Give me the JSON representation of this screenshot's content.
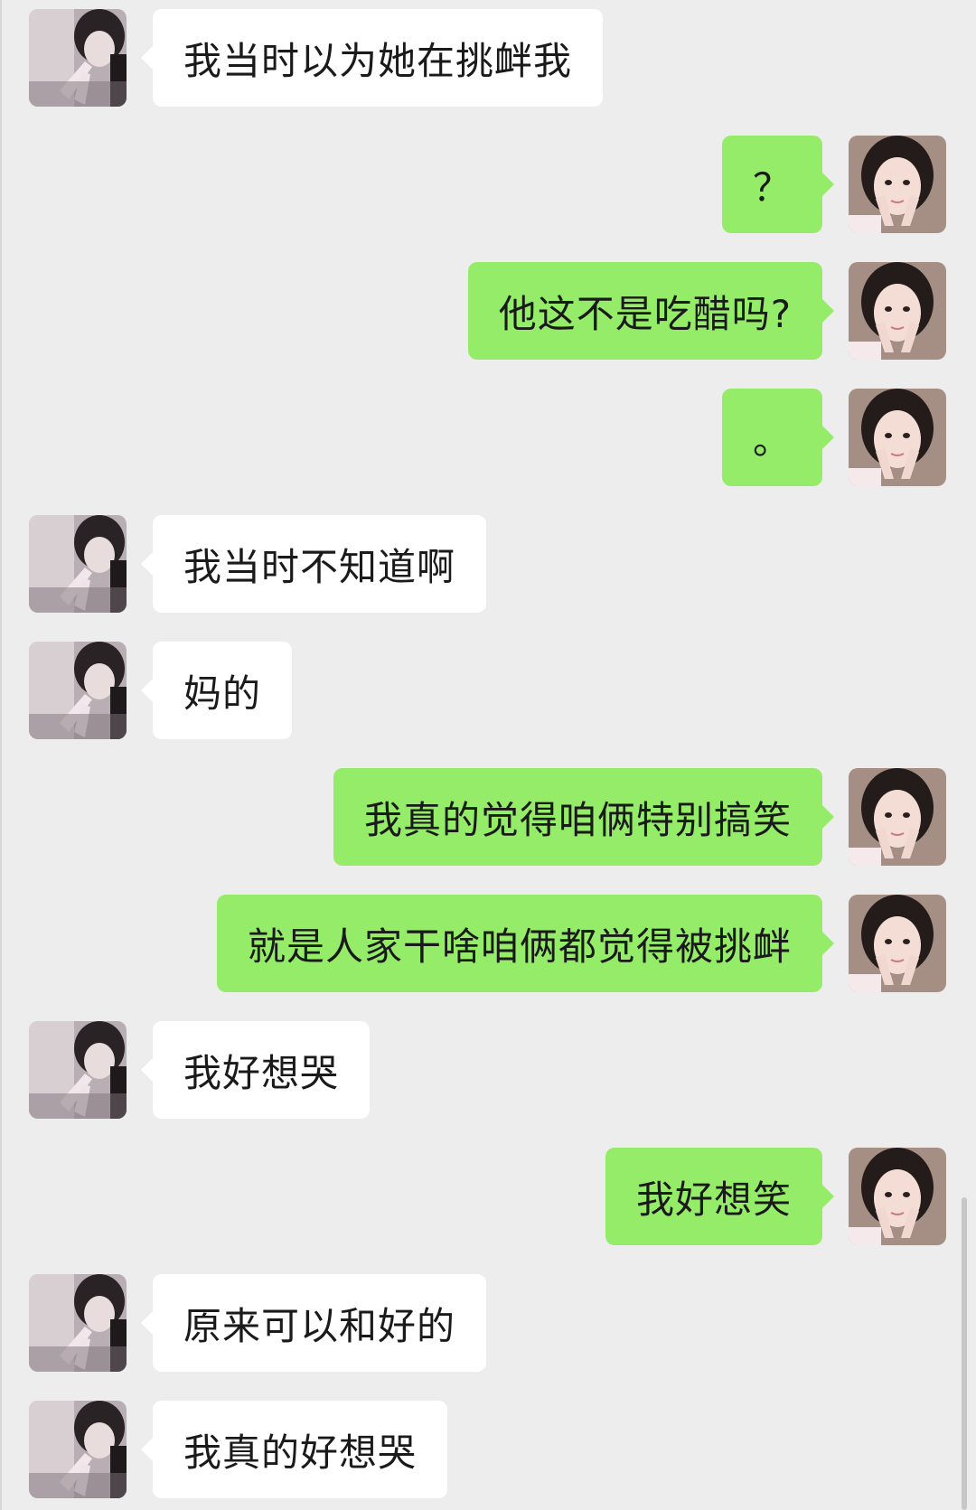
{
  "colors": {
    "background": "#ededed",
    "incoming_bubble": "#ffffff",
    "outgoing_bubble": "#95ec69",
    "text": "#1a1a1a"
  },
  "messages": [
    {
      "side": "in",
      "text": "我当时以为她在挑衅我",
      "avatar": "avatar-icon"
    },
    {
      "side": "out",
      "text": "？",
      "avatar": "avatar-icon"
    },
    {
      "side": "out",
      "text": "他这不是吃醋吗?",
      "avatar": "avatar-icon"
    },
    {
      "side": "out",
      "text": "。",
      "avatar": "avatar-icon"
    },
    {
      "side": "in",
      "text": "我当时不知道啊",
      "avatar": "avatar-icon"
    },
    {
      "side": "in",
      "text": "妈的",
      "avatar": "avatar-icon"
    },
    {
      "side": "out",
      "text": "我真的觉得咱俩特别搞笑",
      "avatar": "avatar-icon"
    },
    {
      "side": "out",
      "text": "就是人家干啥咱俩都觉得被挑衅",
      "avatar": "avatar-icon"
    },
    {
      "side": "in",
      "text": "我好想哭",
      "avatar": "avatar-icon"
    },
    {
      "side": "out",
      "text": "我好想笑",
      "avatar": "avatar-icon"
    },
    {
      "side": "in",
      "text": "原来可以和好的",
      "avatar": "avatar-icon"
    },
    {
      "side": "in",
      "text": "我真的好想哭",
      "avatar": "avatar-icon"
    }
  ]
}
